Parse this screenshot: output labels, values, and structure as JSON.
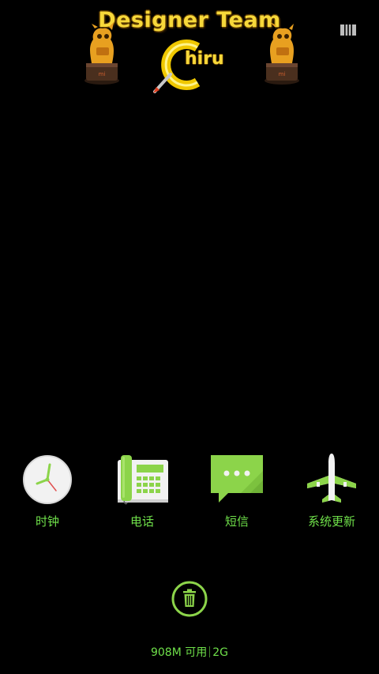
{
  "banner": {
    "title": "Designer Team",
    "logo_text": "hiru",
    "trophy_badge": "mi"
  },
  "dock": {
    "apps": [
      {
        "label": "时钟",
        "icon": "clock-icon"
      },
      {
        "label": "电话",
        "icon": "phone-icon"
      },
      {
        "label": "短信",
        "icon": "message-icon"
      },
      {
        "label": "系统更新",
        "icon": "airplane-icon"
      }
    ]
  },
  "clear_button": {
    "icon": "trash-icon"
  },
  "memory": {
    "free": "908M 可用",
    "network": "2G"
  },
  "colors": {
    "accent": "#6fe04a",
    "icon_green": "#8cd44a",
    "gold": "#f7d83a",
    "background": "#000000"
  }
}
